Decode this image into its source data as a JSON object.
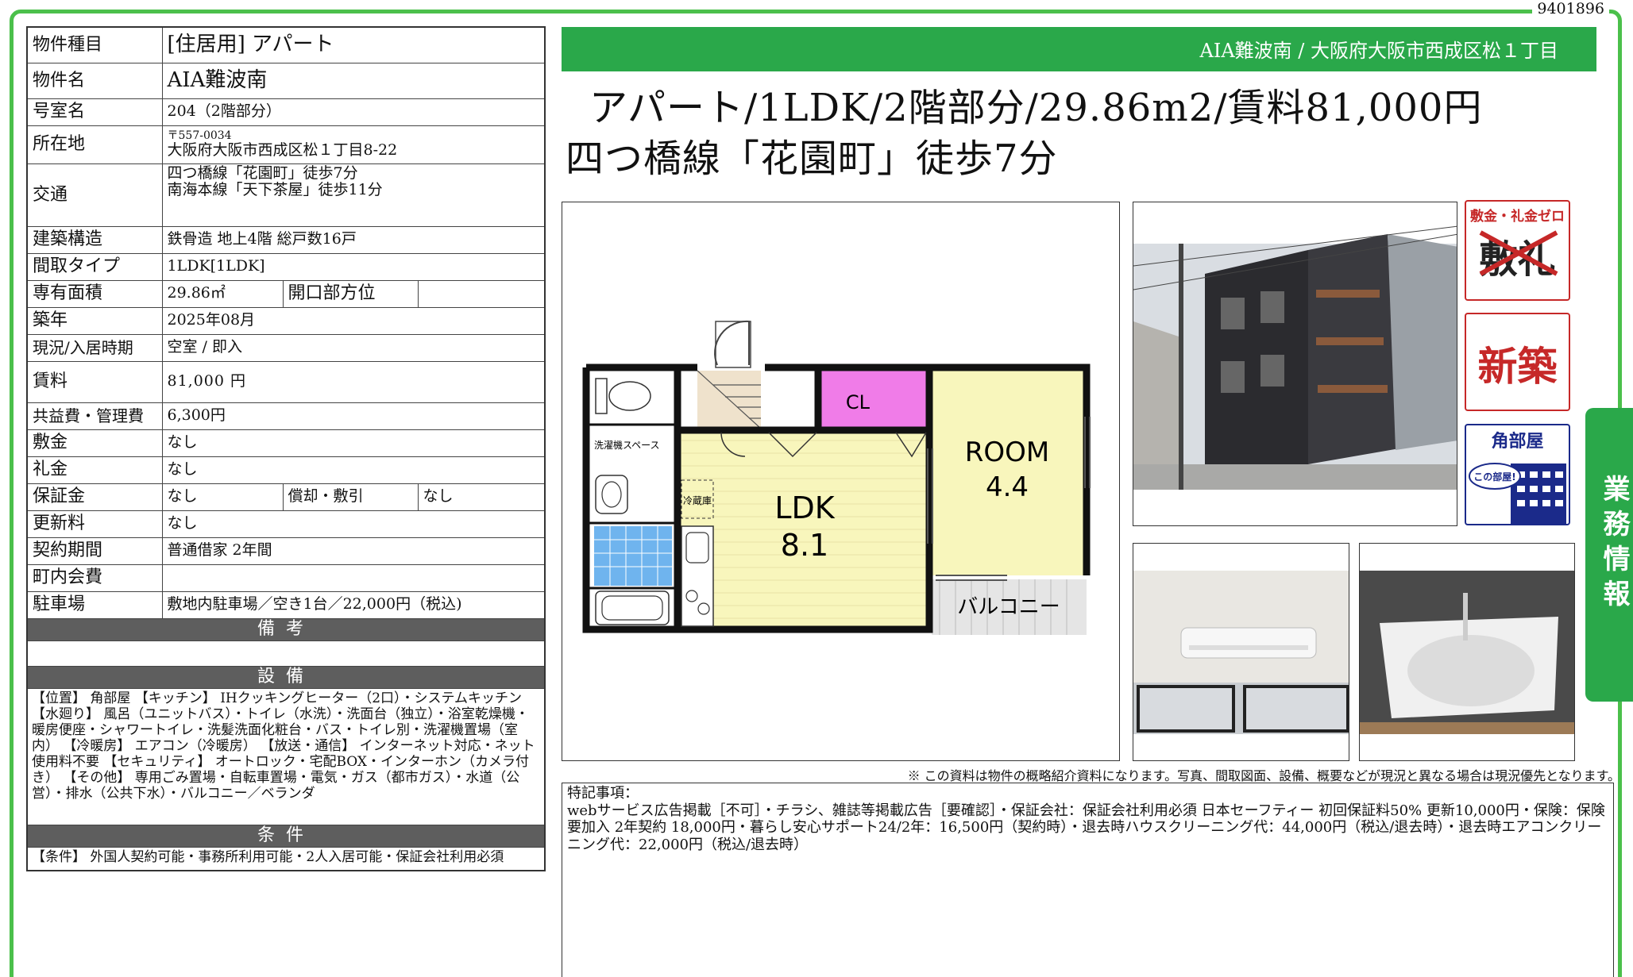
{
  "doc_id": "9401896",
  "spec": {
    "type_label": "物件種目",
    "type_value": "[住居用] アパート",
    "name_label": "物件名",
    "name_value": "AIA難波南",
    "room_label": "号室名",
    "room_value": "204（2階部分）",
    "address_label": "所在地",
    "postal": "〒557-0034",
    "address_value": "大阪府大阪市西成区松１丁目8-22",
    "transit_label": "交通",
    "transit_1": "四つ橋線「花園町」徒歩7分",
    "transit_2": "南海本線「天下茶屋」徒歩11分",
    "structure_label": "建築構造",
    "structure_value": "鉄骨造 地上4階 総戸数16戸",
    "layout_label": "間取タイプ",
    "layout_value": "1LDK[1LDK]",
    "area_label": "専有面積",
    "area_value": "29.86㎡",
    "orientation_label": "開口部方位",
    "orientation_value": "",
    "built_label": "築年",
    "built_value": "2025年08月",
    "status_label": "現況/入居時期",
    "status_value": "空室 / 即入",
    "rent_label": "賃料",
    "rent_value": "81,000 円",
    "fee_label": "共益費・管理費",
    "fee_value": "6,300円",
    "deposit_label": "敷金",
    "deposit_value": "なし",
    "key_label": "礼金",
    "key_value": "なし",
    "guarantee_label": "保証金",
    "guarantee_value": "なし",
    "amort_label": "償却・敷引",
    "amort_value": "なし",
    "renewal_label": "更新料",
    "renewal_value": "なし",
    "contract_label": "契約期間",
    "contract_value": "普通借家 2年間",
    "assoc_label": "町内会費",
    "assoc_value": "",
    "parking_label": "駐車場",
    "parking_value": "敷地内駐車場／空き1台／22,000円（税込)",
    "memo_header": "備考",
    "equip_header": "設備",
    "equip_text": "【位置】 角部屋 【キッチン】 IHクッキングヒーター（2口）・システムキッチン 【水廻り】 風呂（ユニットバス）・トイレ（水洗）・洗面台（独立）・浴室乾燥機・暖房便座・シャワートイレ・洗髪洗面化粧台・バス・トイレ別・洗濯機置場（室内） 【冷暖房】 エアコン（冷暖房） 【放送・通信】 インターネット対応・ネット使用料不要 【セキュリティ】 オートロック・宅配BOX・インターホン（カメラ付き） 【その他】 専用ごみ置場・自転車置場・電気・ガス（都市ガス）・水道（公営）・排水（公共下水）・バルコニー／ベランダ",
    "cond_header": "条件",
    "cond_text": "【条件】 外国人契約可能・事務所利用可能・2人入居可能・保証会社利用必須"
  },
  "header": {
    "bar_text": "AIA難波南 / 大阪府大阪市西成区松１丁目",
    "headline_1": "アパート/1LDK/2階部分/29.86m2/賃料81,000円",
    "headline_2": "四つ橋線「花園町」徒歩7分"
  },
  "floorplan": {
    "cl": "CL",
    "ldk": "LDK",
    "ldk_size": "8.1",
    "room": "ROOM",
    "room_size": "4.4",
    "balcony": "バルコニー",
    "washer": "洗濯機スペース",
    "fridge": "冷蔵庫"
  },
  "badges": {
    "b1_title": "敷金・礼金ゼロ",
    "b1_mark": "敷礼",
    "b2": "新築",
    "b3_title": "角部屋",
    "b3_sub": "この部屋!"
  },
  "side_tab": "業務情報",
  "notice": "※ この資料は物件の概略紹介資料になります。写真、間取図面、設備、概要などが現況と異なる場合は現況優先となります。",
  "remarks_title": "特記事項：",
  "remarks_text": "webサービス広告掲載［不可］・チラシ、雑誌等掲載広告［要確認］・保証会社：保証会社利用必須 日本セーフティー 初回保証料50% 更新10,000円・保険：保険要加入 2年契約 18,000円・暮らし安心サポート24/2年：16,500円（契約時）・退去時ハウスクリーニング代：44,000円（税込/退去時）・退去時エアコンクリーニング代：22,000円（税込/退去時）",
  "colors": {
    "green": "#2aa84a",
    "frame_green": "#4bc04b",
    "section_gray": "#5e5e5e",
    "cl_pink": "#f07ce8",
    "room_yellow": "#f8f6bc",
    "bath_blue": "#6fb4ee",
    "badge_red": "#c62828",
    "badge_navy": "#1b2a8a"
  }
}
